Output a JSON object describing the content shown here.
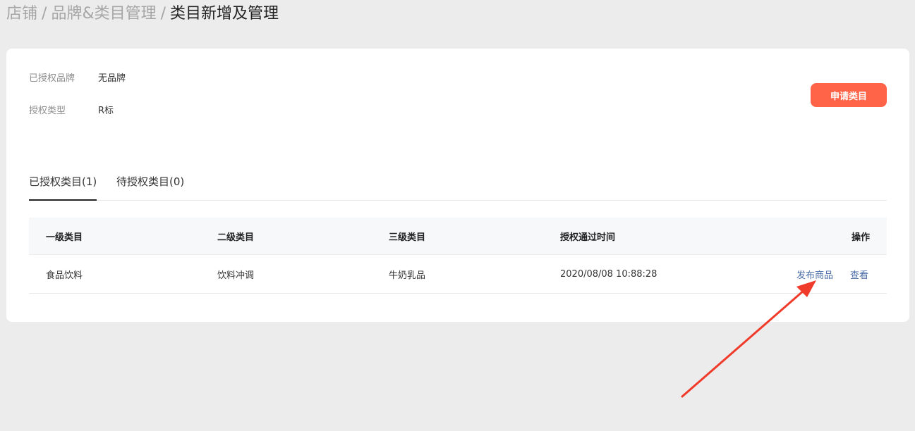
{
  "breadcrumb": {
    "items": [
      "店铺",
      "品牌&类目管理"
    ],
    "separator": "/",
    "current": "类目新增及管理"
  },
  "brand_info": {
    "authorized_brand_label": "已授权品牌",
    "authorized_brand_value": "无品牌",
    "auth_type_label": "授权类型",
    "auth_type_value": "R标"
  },
  "apply_button": {
    "label": "申请类目",
    "color": "#ff6449"
  },
  "tabs": [
    {
      "label": "已授权类目(1)",
      "active": true
    },
    {
      "label": "待授权类目(0)",
      "active": false
    }
  ],
  "table": {
    "headers": [
      "一级类目",
      "二级类目",
      "三级类目",
      "授权通过时间",
      "操作"
    ],
    "rows": [
      {
        "level1": "食品饮料",
        "level2": "饮料冲调",
        "level3": "牛奶乳品",
        "approved_time": "2020/08/08 10:88:28",
        "actions": [
          "发布商品",
          "查看"
        ]
      }
    ]
  },
  "colors": {
    "accent_orange": "#ff6449",
    "link_blue": "#4a6da7",
    "annotation_arrow": "#f03a2a"
  }
}
